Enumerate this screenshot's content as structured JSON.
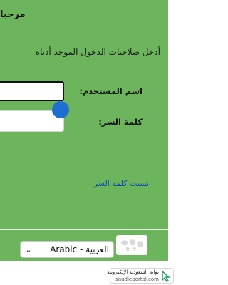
{
  "header": {
    "title": "مرحبا"
  },
  "login": {
    "instructions": "أدخل صلاحيات الدخول الموحد أدناه",
    "username_label": "اسم المستخدم:",
    "password_label": "كلمة السر:",
    "forgot_password": "نسيت كلمة السر"
  },
  "language": {
    "selected": "Arabic - العربية",
    "globe_icon": "globe-map-icon",
    "chevron_icon": "chevron-down-icon"
  },
  "watermark": {
    "line1": "بوابة السعودية الإلكترونية",
    "line2": "saudieportal.com",
    "icon": "cursor-arrow-icon"
  },
  "colors": {
    "panel_bg": "#6db55d",
    "link": "#0b46b9",
    "touch_indicator": "#1f6fd0"
  }
}
